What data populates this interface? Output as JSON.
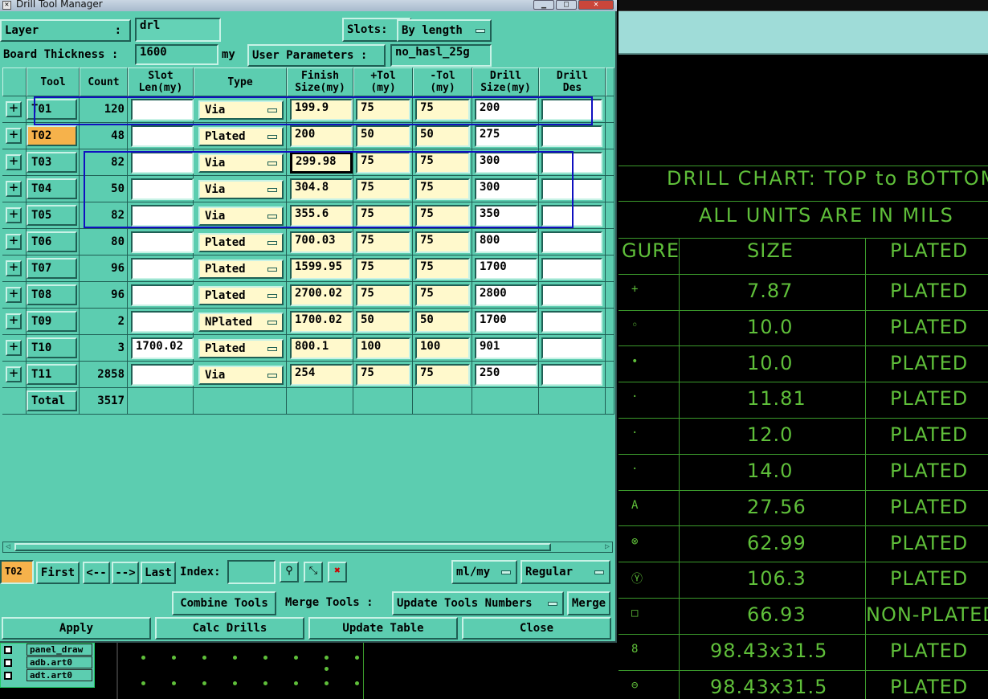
{
  "window": {
    "title": "Drill Tool Manager",
    "minimize": "▁",
    "maximize": "□",
    "close": "✕"
  },
  "header": {
    "layer_label": "Layer",
    "layer_colon": ":",
    "layer_value": "drl",
    "slots_label": "Slots:",
    "slots_value": "By length",
    "board_thickness_label": "Board Thickness :",
    "board_thickness_value": "1600",
    "board_thickness_unit": "my",
    "user_params_label": "User Parameters :",
    "user_params_value": "no_hasl_25g"
  },
  "table": {
    "columns": [
      "Tool",
      "Count",
      "Slot\nLen(my)",
      "Type",
      "Finish\nSize(my)",
      "+Tol\n(my)",
      "-Tol\n(my)",
      "Drill\nSize(my)",
      "Drill\nDes"
    ],
    "rows": [
      {
        "tool": "T01",
        "count": "120",
        "slot": "",
        "type": "Via",
        "finish": "199.9",
        "ptol": "75",
        "mtol": "75",
        "drill": "200"
      },
      {
        "tool": "T02",
        "count": "48",
        "slot": "",
        "type": "Plated",
        "finish": "200",
        "ptol": "50",
        "mtol": "50",
        "drill": "275"
      },
      {
        "tool": "T03",
        "count": "82",
        "slot": "",
        "type": "Via",
        "finish": "299.98",
        "ptol": "75",
        "mtol": "75",
        "drill": "300"
      },
      {
        "tool": "T04",
        "count": "50",
        "slot": "",
        "type": "Via",
        "finish": "304.8",
        "ptol": "75",
        "mtol": "75",
        "drill": "300"
      },
      {
        "tool": "T05",
        "count": "82",
        "slot": "",
        "type": "Via",
        "finish": "355.6",
        "ptol": "75",
        "mtol": "75",
        "drill": "350"
      },
      {
        "tool": "T06",
        "count": "80",
        "slot": "",
        "type": "Plated",
        "finish": "700.03",
        "ptol": "75",
        "mtol": "75",
        "drill": "800"
      },
      {
        "tool": "T07",
        "count": "96",
        "slot": "",
        "type": "Plated",
        "finish": "1599.95",
        "ptol": "75",
        "mtol": "75",
        "drill": "1700"
      },
      {
        "tool": "T08",
        "count": "96",
        "slot": "",
        "type": "Plated",
        "finish": "2700.02",
        "ptol": "75",
        "mtol": "75",
        "drill": "2800"
      },
      {
        "tool": "T09",
        "count": "2",
        "slot": "",
        "type": "NPlated",
        "finish": "1700.02",
        "ptol": "50",
        "mtol": "50",
        "drill": "1700"
      },
      {
        "tool": "T10",
        "count": "3",
        "slot": "1700.02",
        "type": "Plated",
        "finish": "800.1",
        "ptol": "100",
        "mtol": "100",
        "drill": "901"
      },
      {
        "tool": "T11",
        "count": "2858",
        "slot": "",
        "type": "Via",
        "finish": "254",
        "ptol": "75",
        "mtol": "75",
        "drill": "250"
      }
    ],
    "total_label": "Total",
    "total_value": "3517"
  },
  "nav": {
    "current_tool": "T02",
    "first": "First",
    "prev": "<--",
    "next": "-->",
    "last": "Last",
    "index_label": "Index:",
    "index_value": "",
    "units": "ml/my",
    "mode": "Regular"
  },
  "actions": {
    "combine": "Combine Tools",
    "merge_label": "Merge Tools :",
    "update_numbers": "Update Tools Numbers",
    "merge": "Merge",
    "apply": "Apply",
    "calc": "Calc Drills",
    "update_table": "Update Table",
    "close": "Close"
  },
  "drill_chart": {
    "title1": "DRILL CHART: TOP to BOTTOM",
    "title2": "ALL UNITS ARE IN MILS",
    "headers": [
      "GURE",
      "SIZE",
      "PLATED"
    ],
    "rows": [
      {
        "sym": "+",
        "size": "7.87",
        "plated": "PLATED"
      },
      {
        "sym": "◦",
        "size": "10.0",
        "plated": "PLATED"
      },
      {
        "sym": "•",
        "size": "10.0",
        "plated": "PLATED"
      },
      {
        "sym": "·",
        "size": "11.81",
        "plated": "PLATED"
      },
      {
        "sym": "·",
        "size": "12.0",
        "plated": "PLATED"
      },
      {
        "sym": "·",
        "size": "14.0",
        "plated": "PLATED"
      },
      {
        "sym": "A",
        "size": "27.56",
        "plated": "PLATED"
      },
      {
        "sym": "⊗",
        "size": "62.99",
        "plated": "PLATED"
      },
      {
        "sym": "Ⓨ",
        "size": "106.3",
        "plated": "PLATED"
      },
      {
        "sym": "□",
        "size": "66.93",
        "plated": "NON-PLATED"
      },
      {
        "sym": "8",
        "size": "98.43x31.5",
        "plated": "PLATED"
      },
      {
        "sym": "⊖",
        "size": "98.43x31.5",
        "plated": "PLATED"
      }
    ]
  },
  "layers": [
    "panel_draw",
    "adb.art0",
    "adt.art0"
  ]
}
